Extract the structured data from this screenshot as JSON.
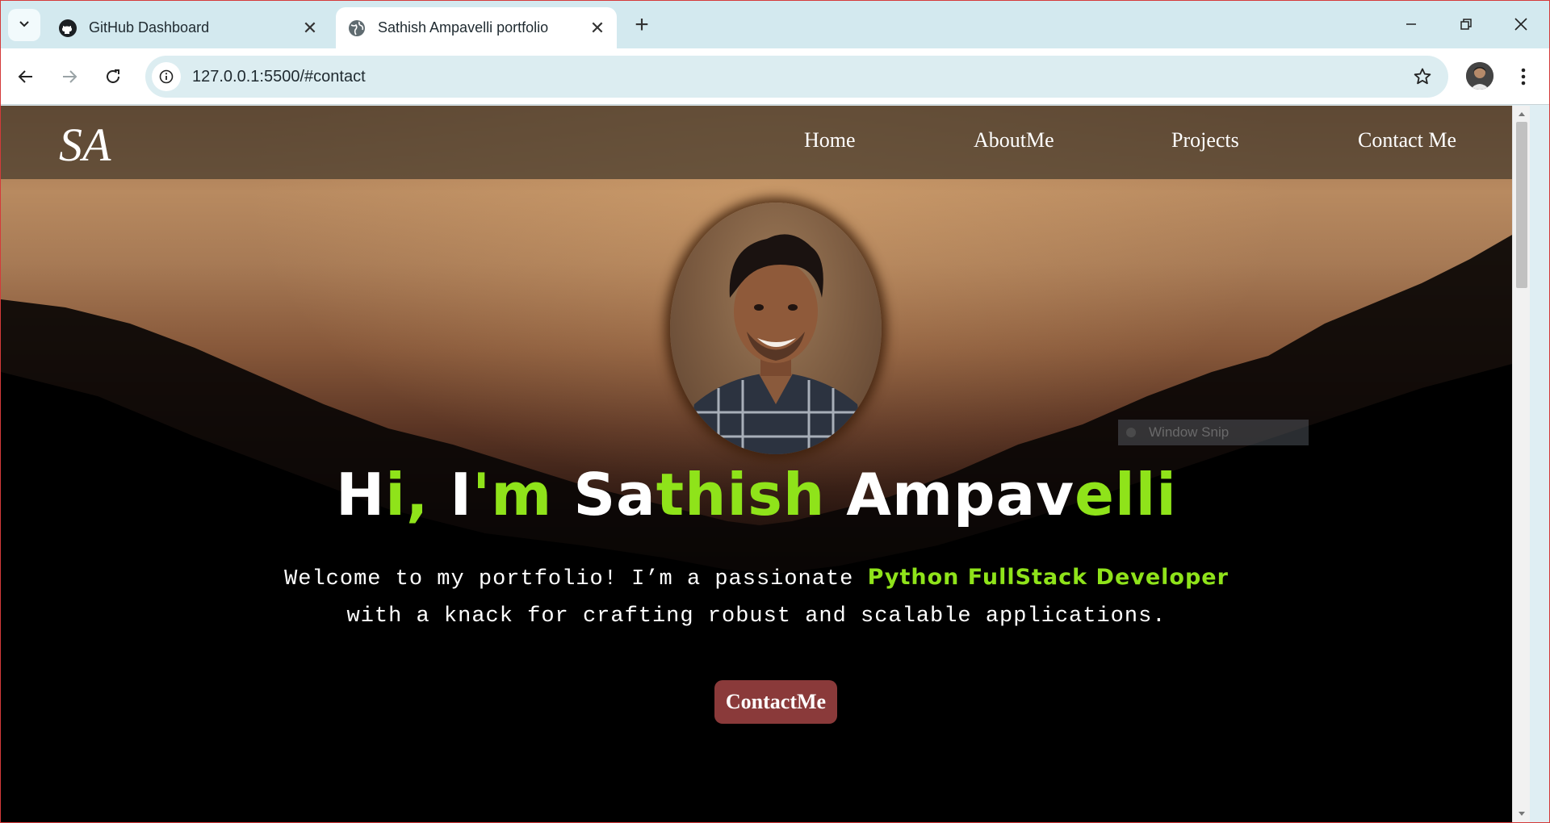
{
  "browser": {
    "tabs": [
      {
        "title": "GitHub Dashboard",
        "active": false,
        "icon": "github-icon"
      },
      {
        "title": "Sathish Ampavelli portfolio",
        "active": true,
        "icon": "globe-icon"
      }
    ],
    "url": "127.0.0.1:5500/#contact"
  },
  "site": {
    "logo_text": "SA",
    "nav": [
      "Home",
      "AboutMe",
      "Projects",
      "Contact Me"
    ],
    "hero": {
      "title_parts": [
        {
          "text": "H",
          "green": false
        },
        {
          "text": "i, ",
          "green": true
        },
        {
          "text": "I",
          "green": false
        },
        {
          "text": "'m ",
          "green": true
        },
        {
          "text": "Sa",
          "green": false
        },
        {
          "text": "thish",
          "green": true
        },
        {
          "text": " Ampav",
          "green": false
        },
        {
          "text": "elli",
          "green": true
        }
      ],
      "intro_before": "Welcome to my portfolio! I’m a passionate ",
      "intro_highlight": "Python FullStack Developer",
      "intro_after": "with a knack for crafting robust and scalable applications.",
      "cta_label": "ContactMe"
    },
    "overlay_text": "Window Snip"
  },
  "colors": {
    "accent_green": "#8fe31a",
    "cta_bg": "#8a3a3a",
    "nav_bg": "rgba(78,64,48,0.78)"
  }
}
